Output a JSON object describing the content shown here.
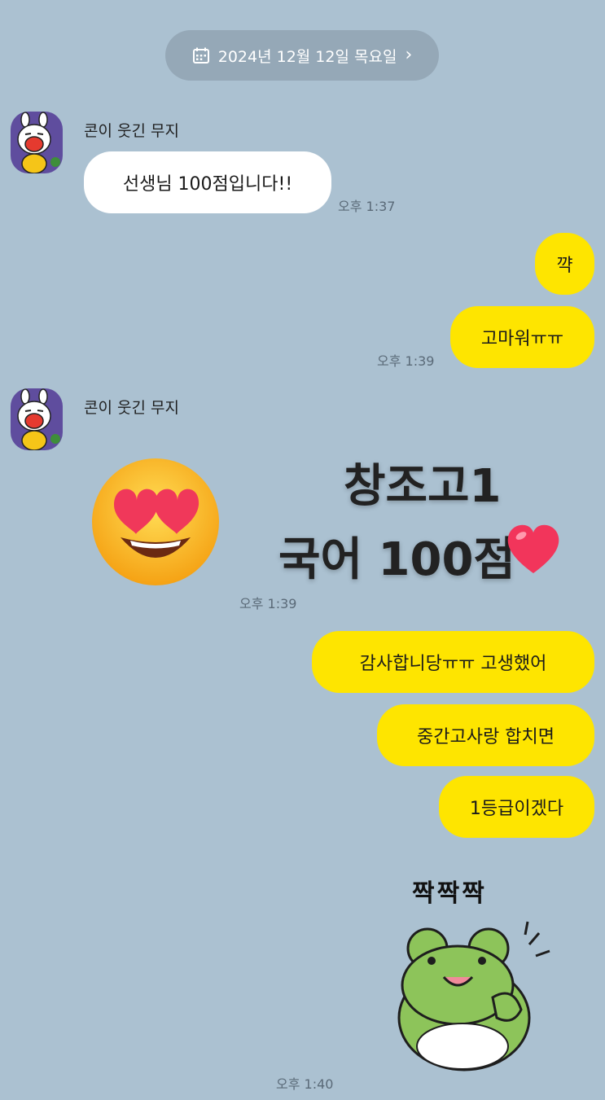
{
  "date_banner": {
    "text": "2024년 12월 12일 목요일"
  },
  "messages": [
    {
      "sender": "콘이 웃긴 무지",
      "text": "선생님 100점입니다!!",
      "time": "오후 1:37"
    },
    {
      "text": "꺅"
    },
    {
      "text": "고마워ㅠㅠ",
      "time": "오후 1:39"
    },
    {
      "sender": "콘이 웃긴 무지",
      "image_line1": "창조고1",
      "image_line2": "국어 100점",
      "time": "오후 1:39"
    },
    {
      "text": "감사합니당ㅠㅠ 고생했어"
    },
    {
      "text": "중간고사랑 합치면"
    },
    {
      "text": "1등급이겠다"
    },
    {
      "sticker_text": "짝짝짝",
      "time": "오후 1:40"
    }
  ],
  "icons": {
    "calendar": "calendar-icon",
    "chevron": "chevron-right-icon",
    "heart_eyes": "heart-eyes-emoji",
    "heart": "red-heart-emoji",
    "frog": "frog-sticker"
  },
  "colors": {
    "background": "#abc1d1",
    "my_bubble": "#fee500",
    "their_bubble": "#ffffff",
    "date_pill": "#95a8b7"
  }
}
